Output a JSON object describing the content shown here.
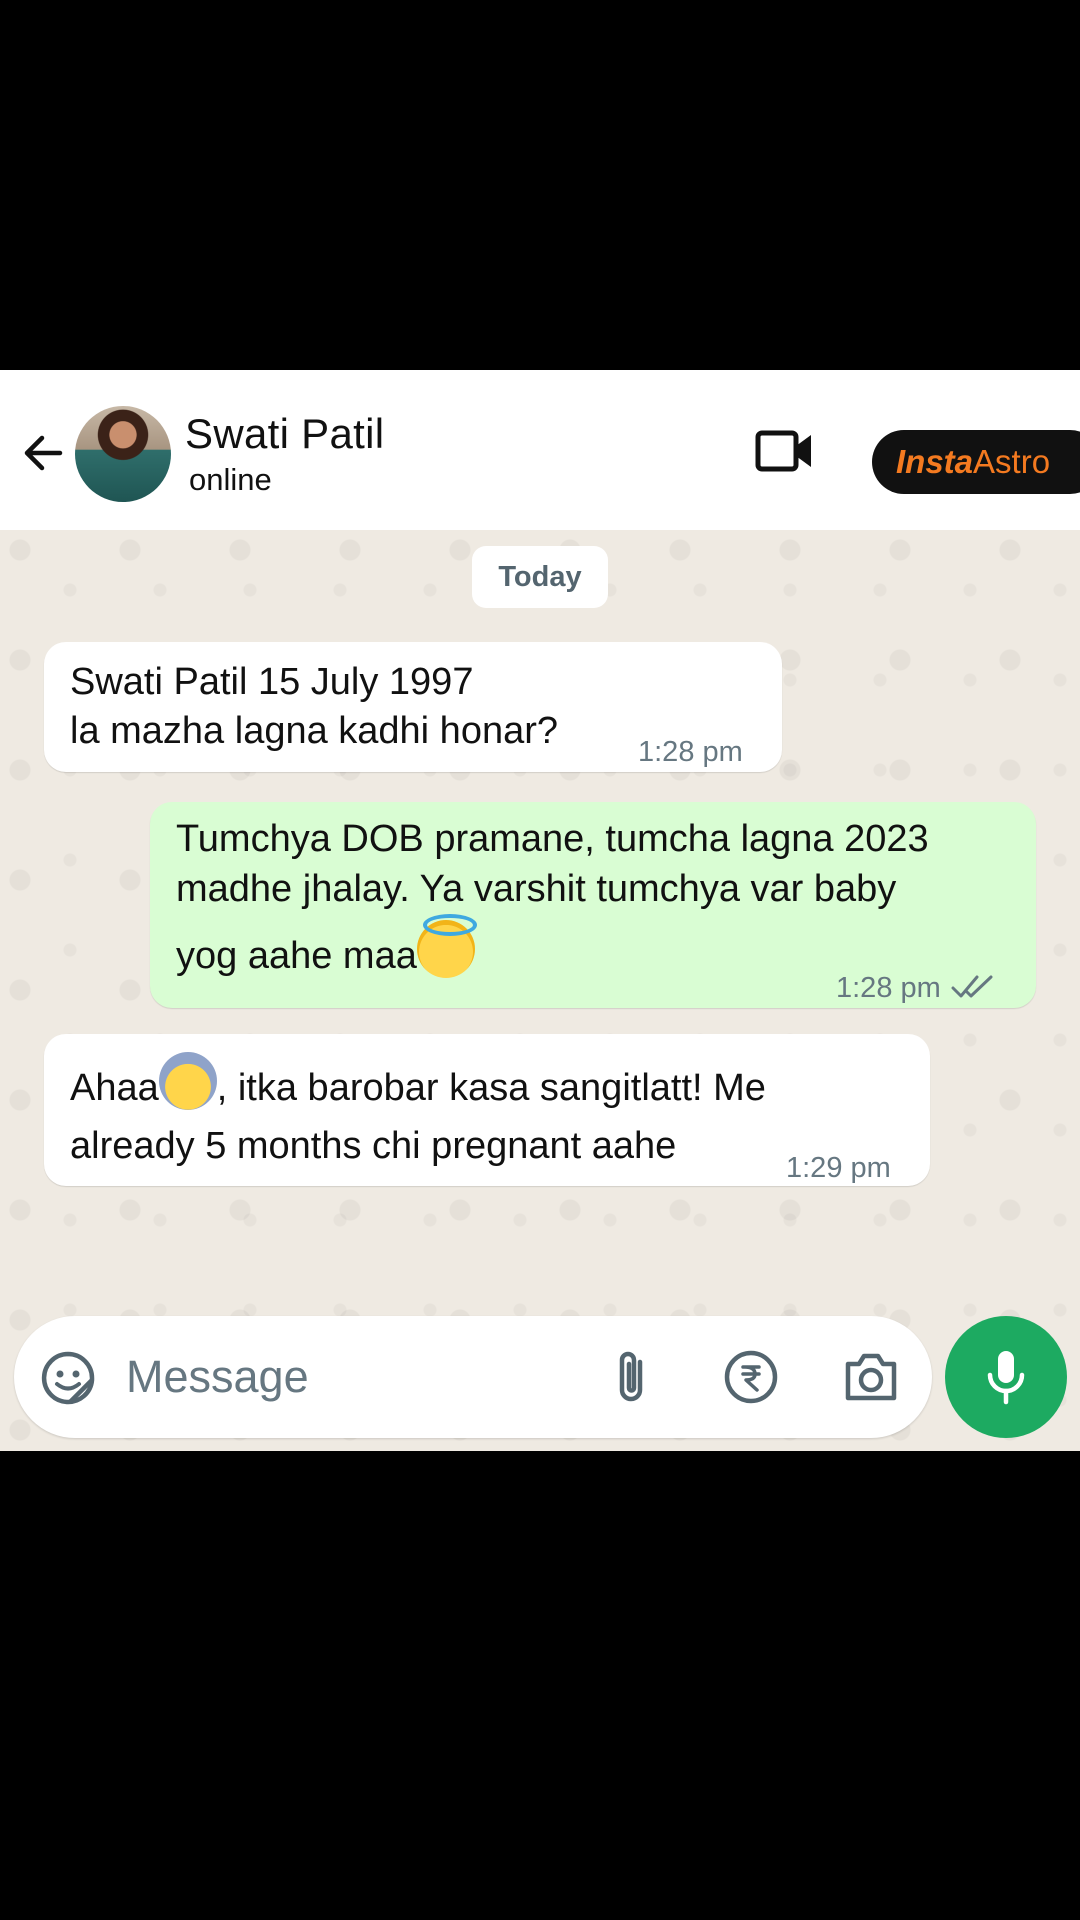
{
  "header": {
    "contact_name": "Swati Patil",
    "contact_status": "online",
    "badge_part_a": "Insta",
    "badge_part_b": "Astro"
  },
  "chat": {
    "date_chip": "Today",
    "messages": [
      {
        "direction": "incoming",
        "line1": "Swati Patil 15 July 1997",
        "line2": "la mazha lagna kadhi honar?",
        "time": "1:28 pm"
      },
      {
        "direction": "outgoing",
        "line1": "Tumchya DOB pramane, tumcha lagna 2023",
        "line2": "madhe jhalay. Ya varshit tumchya var baby",
        "line3": "yog aahe maa",
        "emoji": "smiling-face-with-halo",
        "time": "1:28 pm",
        "status": "read"
      },
      {
        "direction": "incoming",
        "line1_a": "Ahaa",
        "emoji": "face-screaming-in-fear",
        "line1_b": ", itka barobar kasa sangitlatt! Me",
        "line2": "already 5 months chi pregnant aahe",
        "time": "1:29 pm"
      }
    ]
  },
  "composer": {
    "placeholder": "Message"
  },
  "colors": {
    "chat_background": "#efeae2",
    "outgoing_bubble": "#d9fdd3",
    "incoming_bubble": "#ffffff",
    "mic_button": "#1daa61",
    "badge_text": "#f47a20"
  },
  "icons": [
    "back-arrow-icon",
    "video-call-icon",
    "sticker-icon",
    "attach-icon",
    "rupee-icon",
    "camera-icon",
    "mic-icon",
    "double-check-icon"
  ]
}
